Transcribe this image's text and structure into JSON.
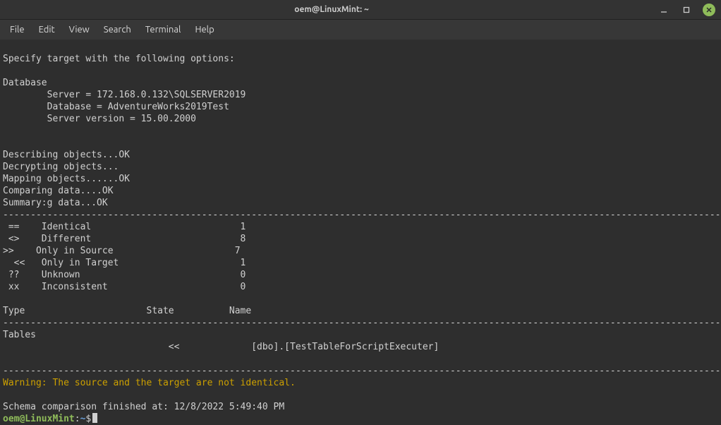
{
  "window": {
    "title": "oem@LinuxMint: ~"
  },
  "menu": {
    "file": "File",
    "edit": "Edit",
    "view": "View",
    "search": "Search",
    "terminal": "Terminal",
    "help": "Help"
  },
  "output": {
    "l1": "Specify target with the following options:",
    "l2": "",
    "l3": "Database",
    "l4": "        Server = 172.168.0.132\\SQLSERVER2019",
    "l5": "        Database = AdventureWorks2019Test",
    "l6": "        Server version = 15.00.2000",
    "l7": "",
    "l8": "",
    "l9": "Describing objects...OK",
    "l10": "Decrypting objects...",
    "l11": "Mapping objects......OK",
    "l12": "Comparing data....OK",
    "l13": "Summary:g data...OK",
    "dash": "-------------------------------------------------------------------------------------------------------------------------------------",
    "s1": " ==    Identical                           1",
    "s2": " <>    Different                           8",
    "s3": ">>    Only in Source                      7",
    "s4": "  <<   Only in Target                      1",
    "s5": " ??    Unknown                             0",
    "s6": " xx    Inconsistent                        0",
    "blank": "",
    "hdr": "Type                      State          Name",
    "tables": "Tables",
    "row1": "                              <<             [dbo].[TestTableForScriptExecuter]",
    "warn": "Warning: The source and the target are not identical.",
    "finish": "Schema comparison finished at: 12/8/2022 5:49:40 PM"
  },
  "prompt": {
    "user": "oem@LinuxMint",
    "sep1": ":",
    "path": "~",
    "sep2": "$"
  }
}
